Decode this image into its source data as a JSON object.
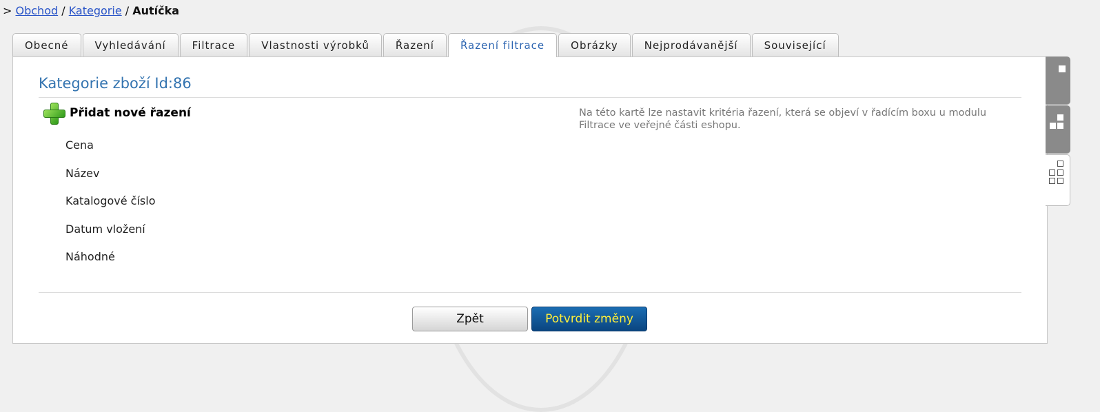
{
  "breadcrumb": {
    "prefix": ">",
    "items": [
      "Obchod",
      "Kategorie"
    ],
    "separator": "/",
    "current": "Autíčka"
  },
  "tabs": [
    {
      "label": "Obecné"
    },
    {
      "label": "Vyhledávání"
    },
    {
      "label": "Filtrace"
    },
    {
      "label": "Vlastnosti výrobků"
    },
    {
      "label": "Řazení"
    },
    {
      "label": "Řazení filtrace",
      "active": true
    },
    {
      "label": "Obrázky"
    },
    {
      "label": "Nejprodávanější"
    },
    {
      "label": "Související"
    }
  ],
  "main": {
    "heading": "Kategorie zboží Id:86",
    "add_label": "Přidat nové řazení",
    "sort_items": [
      "Cena",
      "Název",
      "Katalogové číslo",
      "Datum vložení",
      "Náhodné"
    ],
    "help_text": "Na této kartě lze nastavit kritéria řazení, která se objeví v řadícím boxu u modulu Filtrace ve veřejné části eshopu."
  },
  "buttons": {
    "back": "Zpět",
    "submit": "Potvrdit změny"
  },
  "side_tabs": [
    {
      "icon": "single-square-icon"
    },
    {
      "icon": "three-squares-icon"
    },
    {
      "icon": "grid-squares-icon",
      "active": true
    }
  ],
  "colors": {
    "accent": "#3474b0",
    "link": "#2a55c8",
    "submit_bg": "#0a4580",
    "submit_text": "#ffef3a"
  }
}
